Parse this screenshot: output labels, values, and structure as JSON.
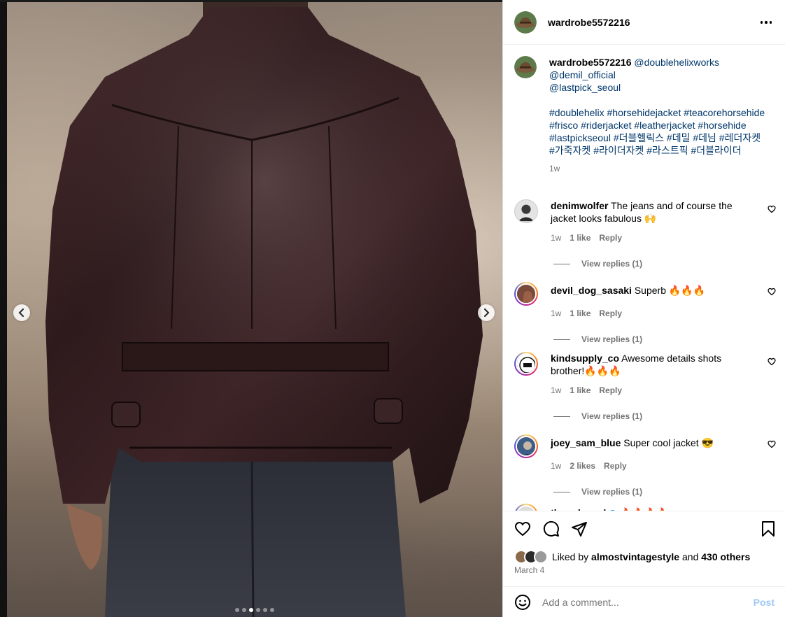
{
  "post": {
    "username": "wardrobe5572216",
    "caption_mentions": [
      "@doublehelixworks",
      "@demil_official",
      "@lastpick_seoul"
    ],
    "caption_tags": "#doublehelix #horsehidejacket #teacorehorsehide #frisco #riderjacket #leatherjacket #horsehide #lastpickseoul #더블헬릭스 #데밀 #데님 #레더자켓 #가죽자켓 #라이더자켓 #라스트픽 #더블라이더",
    "caption_time": "1w",
    "liked_by_prefix": "Liked by",
    "liked_by_user": "almostvintagestyle",
    "liked_by_and": "and",
    "liked_by_others": "430 others",
    "date": "March 4",
    "comment_placeholder": "Add a comment...",
    "post_button": "Post"
  },
  "media": {
    "slide_count": 6,
    "active_slide": 3
  },
  "comments": [
    {
      "user": "denimwolfer",
      "text": "The jeans and of course the jacket looks fabulous 🙌",
      "time": "1w",
      "likes": "1 like",
      "reply": "Reply",
      "replies": "View replies (1)"
    },
    {
      "user": "devil_dog_sasaki",
      "text": "Superb 🔥🔥🔥",
      "time": "1w",
      "likes": "1 like",
      "reply": "Reply",
      "replies": "View replies (1)"
    },
    {
      "user": "kindsupply_co",
      "text": "Awesome details shots brother!🔥🔥🔥",
      "time": "1w",
      "likes": "1 like",
      "reply": "Reply",
      "replies": "View replies (1)"
    },
    {
      "user": "joey_sam_blue",
      "text": "Super cool jacket 😎",
      "time": "1w",
      "likes": "2 likes",
      "reply": "Reply",
      "replies": "View replies (1)"
    },
    {
      "user": "threads_md",
      "text": "🔥🔥🔥🔥"
    }
  ],
  "icons": {
    "more": "more-options-icon",
    "like": "heart-icon",
    "comment": "comment-icon",
    "share": "share-icon",
    "save": "bookmark-icon",
    "emoji": "emoji-icon",
    "prev": "chevron-left-icon",
    "next": "chevron-right-icon"
  },
  "colors": {
    "link": "#00376b",
    "muted": "#737373",
    "post_button": "#9ec8f5",
    "verified": "#0095f6"
  }
}
